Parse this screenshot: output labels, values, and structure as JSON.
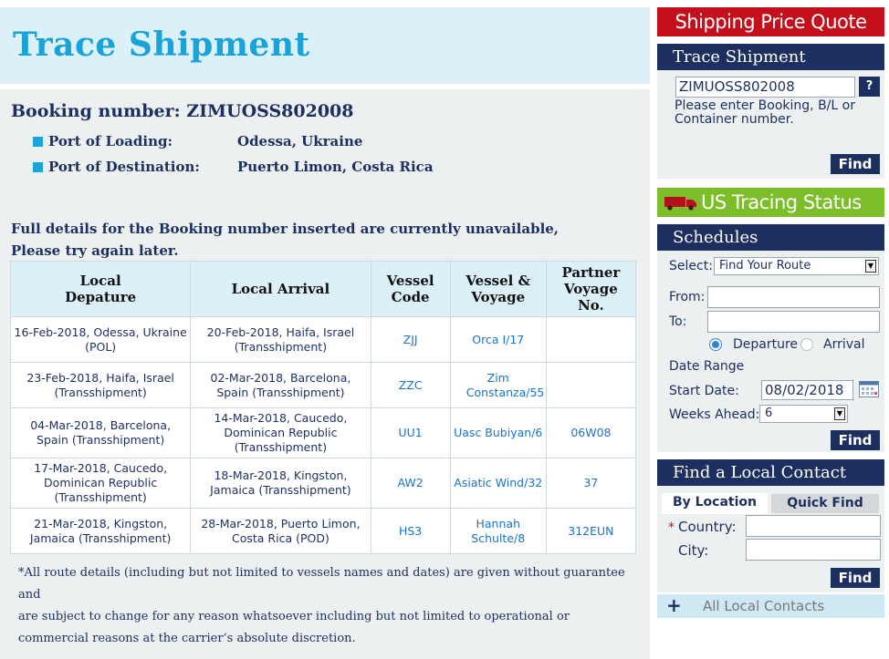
{
  "page": {
    "title": "Trace Shipment",
    "booking_label": "Booking number: ZIMUOSS802008",
    "ports": [
      {
        "label": "Port of Loading:",
        "value": "Odessa, Ukraine"
      },
      {
        "label": "Port of Destination:",
        "value": "Puerto Limon, Costa Rica"
      }
    ],
    "warning_line1": "Full details for the Booking number inserted are currently unavailable,",
    "warning_line2": "Please try again later.",
    "table": {
      "headers": [
        "Local Depature",
        "Local Arrival",
        "Vessel Code",
        "Vessel & Voyage",
        "Partner Voyage No."
      ],
      "rows": [
        {
          "departure": "16-Feb-2018, Odessa, Ukraine (POL)",
          "arrival": "20-Feb-2018, Haifa, Israel (Transshipment)",
          "vessel_code": "ZJJ",
          "vessel_voyage": "Orca I/17",
          "partner": ""
        },
        {
          "departure": "23-Feb-2018, Haifa, Israel (Transshipment)",
          "arrival": "02-Mar-2018, Barcelona, Spain (Transshipment)",
          "vessel_code": "ZZC",
          "vessel_voyage": "Zim Constanza/55",
          "partner": ""
        },
        {
          "departure": "04-Mar-2018, Barcelona, Spain (Transshipment)",
          "arrival": "14-Mar-2018, Caucedo, Dominican Republic (Transshipment)",
          "vessel_code": "UU1",
          "vessel_voyage": "Uasc Bubiyan/6",
          "partner": "06W08"
        },
        {
          "departure": "17-Mar-2018, Caucedo, Dominican Republic (Transshipment)",
          "arrival": "18-Mar-2018, Kingston, Jamaica (Transshipment)",
          "vessel_code": "AW2",
          "vessel_voyage": "Asiatic Wind/32",
          "partner": "37"
        },
        {
          "departure": "21-Mar-2018, Kingston, Jamaica (Transshipment)",
          "arrival": "28-Mar-2018, Puerto Limon, Costa Rica (POD)",
          "vessel_code": "HS3",
          "vessel_voyage": "Hannah Schulte/8",
          "partner": "312EUN"
        }
      ]
    },
    "disclaimer_line1": "*All route details (including but not limited to vessels names and dates) are given without guarantee and",
    "disclaimer_line2": "are subject to change for any reason whatsoever including but not limited to operational or commercial reasons at the carrier’s absolute discretion."
  },
  "sidebar": {
    "price_quote": "Shipping Price Quote",
    "trace": {
      "title": "Trace Shipment",
      "input_value": "ZIMUOSS802008",
      "help": "?",
      "hint": "Please enter Booking, B/L or Container number.",
      "find": "Find"
    },
    "us_tracing": "US Tracing Status",
    "schedules": {
      "title": "Schedules",
      "select_label": "Select:",
      "select_value": "Find Your Route",
      "from_label": "From:",
      "to_label": "To:",
      "departure": "Departure",
      "arrival": "Arrival",
      "date_range": "Date Range",
      "start_label": "Start Date:",
      "start_value": "08/02/2018",
      "weeks_label": "Weeks Ahead:",
      "weeks_value": "6",
      "find": "Find"
    },
    "contact": {
      "title": "Find a Local Contact",
      "tab_location": "By Location",
      "tab_quick": "Quick Find",
      "required_mark": "*",
      "country_label": "Country:",
      "city_label": "City:",
      "find": "Find",
      "all_contacts": "All Local Contacts"
    }
  },
  "colors": {
    "navy": "#1c2f5e",
    "accent_blue": "#1aa3d9",
    "promo_red": "#c4101c",
    "promo_green": "#7cbd2a"
  }
}
